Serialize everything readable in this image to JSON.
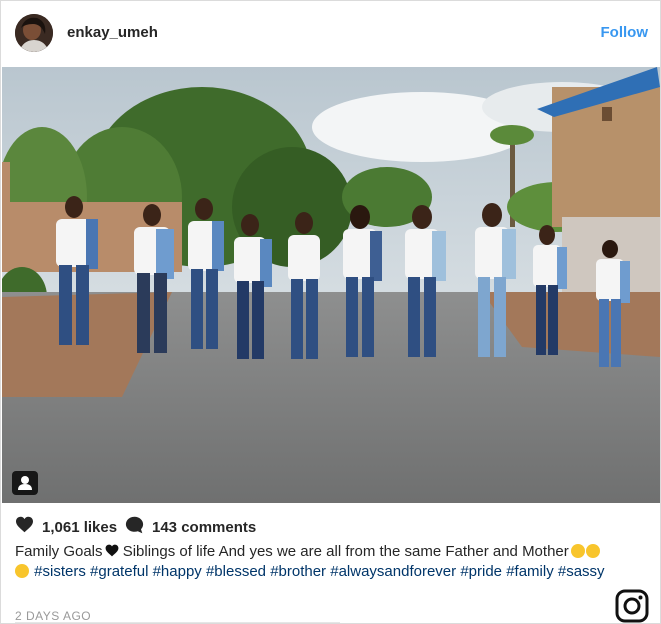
{
  "post": {
    "username": "enkay_umeh",
    "follow_label": "Follow",
    "likes": "1,061 likes",
    "comments": "143 comments",
    "caption_text": "Family Goals",
    "caption_text2": " Siblings of life And yes we are all from the same Father and Mother",
    "hashtags": [
      "#sisters",
      "#grateful",
      "#happy",
      "#blessed",
      "#brother",
      "#alwaysandforever",
      "#pride",
      "#family",
      "#sassy"
    ],
    "timestamp": "2 DAYS AGO"
  },
  "colors": {
    "follow": "#3897f0",
    "hashtag": "#003569",
    "text": "#262626",
    "muted": "#999999"
  },
  "icons": [
    "heart-icon",
    "comment-bubble-icon",
    "user-tag-icon",
    "instagram-logo-icon"
  ]
}
